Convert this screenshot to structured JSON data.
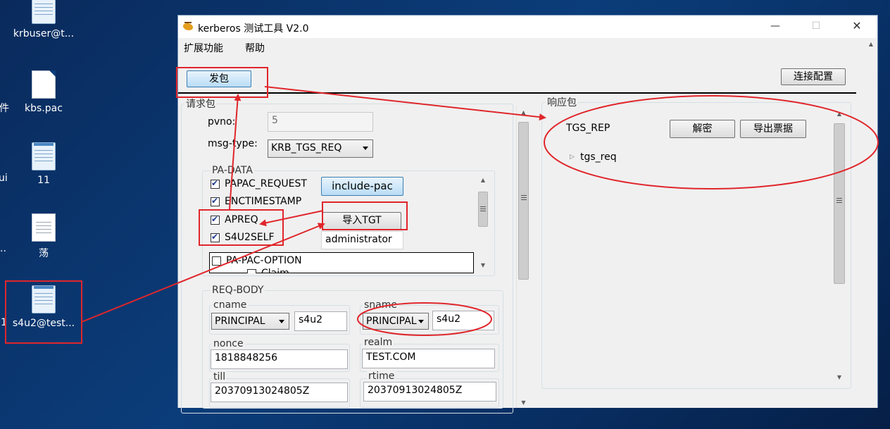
{
  "desktop": {
    "icons": [
      {
        "label": "krbuser@t..."
      },
      {
        "label": "kbs.pac"
      },
      {
        "label": "11"
      },
      {
        "label": "荡"
      },
      {
        "label": "s4u2@test..."
      }
    ],
    "left_clips": [
      "件",
      "ui",
      "..",
      "1"
    ]
  },
  "window": {
    "title": "kerberos 测试工具 V2.0",
    "controls": {
      "minimize": "—",
      "maximize": "☐",
      "close": "✕"
    },
    "menu": [
      "扩展功能",
      "帮助"
    ],
    "send_button": "发包",
    "connect_config_button": "连接配置"
  },
  "request": {
    "group_label": "请求包",
    "pvno_label": "pvno:",
    "pvno_value": "5",
    "msg_type_label": "msg-type:",
    "msg_type_value": "KRB_TGS_REQ",
    "pa_data": {
      "label": "PA-DATA",
      "items": [
        {
          "label": "PAPAC_REQUEST",
          "checked": true
        },
        {
          "label": "ENCTIMESTAMP",
          "checked": true
        },
        {
          "label": "APREQ",
          "checked": true
        },
        {
          "label": "S4U2SELF",
          "checked": true
        }
      ],
      "include_pac_button": "include-pac",
      "import_tgt_button": "导入TGT",
      "s4u2self_user": "administrator",
      "pac_option_label": "PA-PAC-OPTION",
      "pac_option_checked": false,
      "claim_label": "Claim"
    },
    "req_body": {
      "label": "REQ-BODY",
      "cname_label": "cname",
      "cname_type": "PRINCIPAL",
      "cname_value": "s4u2",
      "sname_label": "sname",
      "sname_type": "PRINCIPAL",
      "sname_value": "s4u2",
      "nonce_label": "nonce",
      "nonce_value": "1818848256",
      "realm_label": "realm",
      "realm_value": "TEST.COM",
      "till_label": "till",
      "till_value": "20370913024805Z",
      "rtime_label": "rtime",
      "rtime_value": "20370913024805Z"
    }
  },
  "response": {
    "group_label": "响应包",
    "type": "TGS_REP",
    "decrypt_button": "解密",
    "export_ticket_button": "导出票据",
    "tree_node": "tgs_req"
  },
  "colors": {
    "annotation_red": "#e0262b",
    "desktop_blue": "#0b3d7a"
  }
}
